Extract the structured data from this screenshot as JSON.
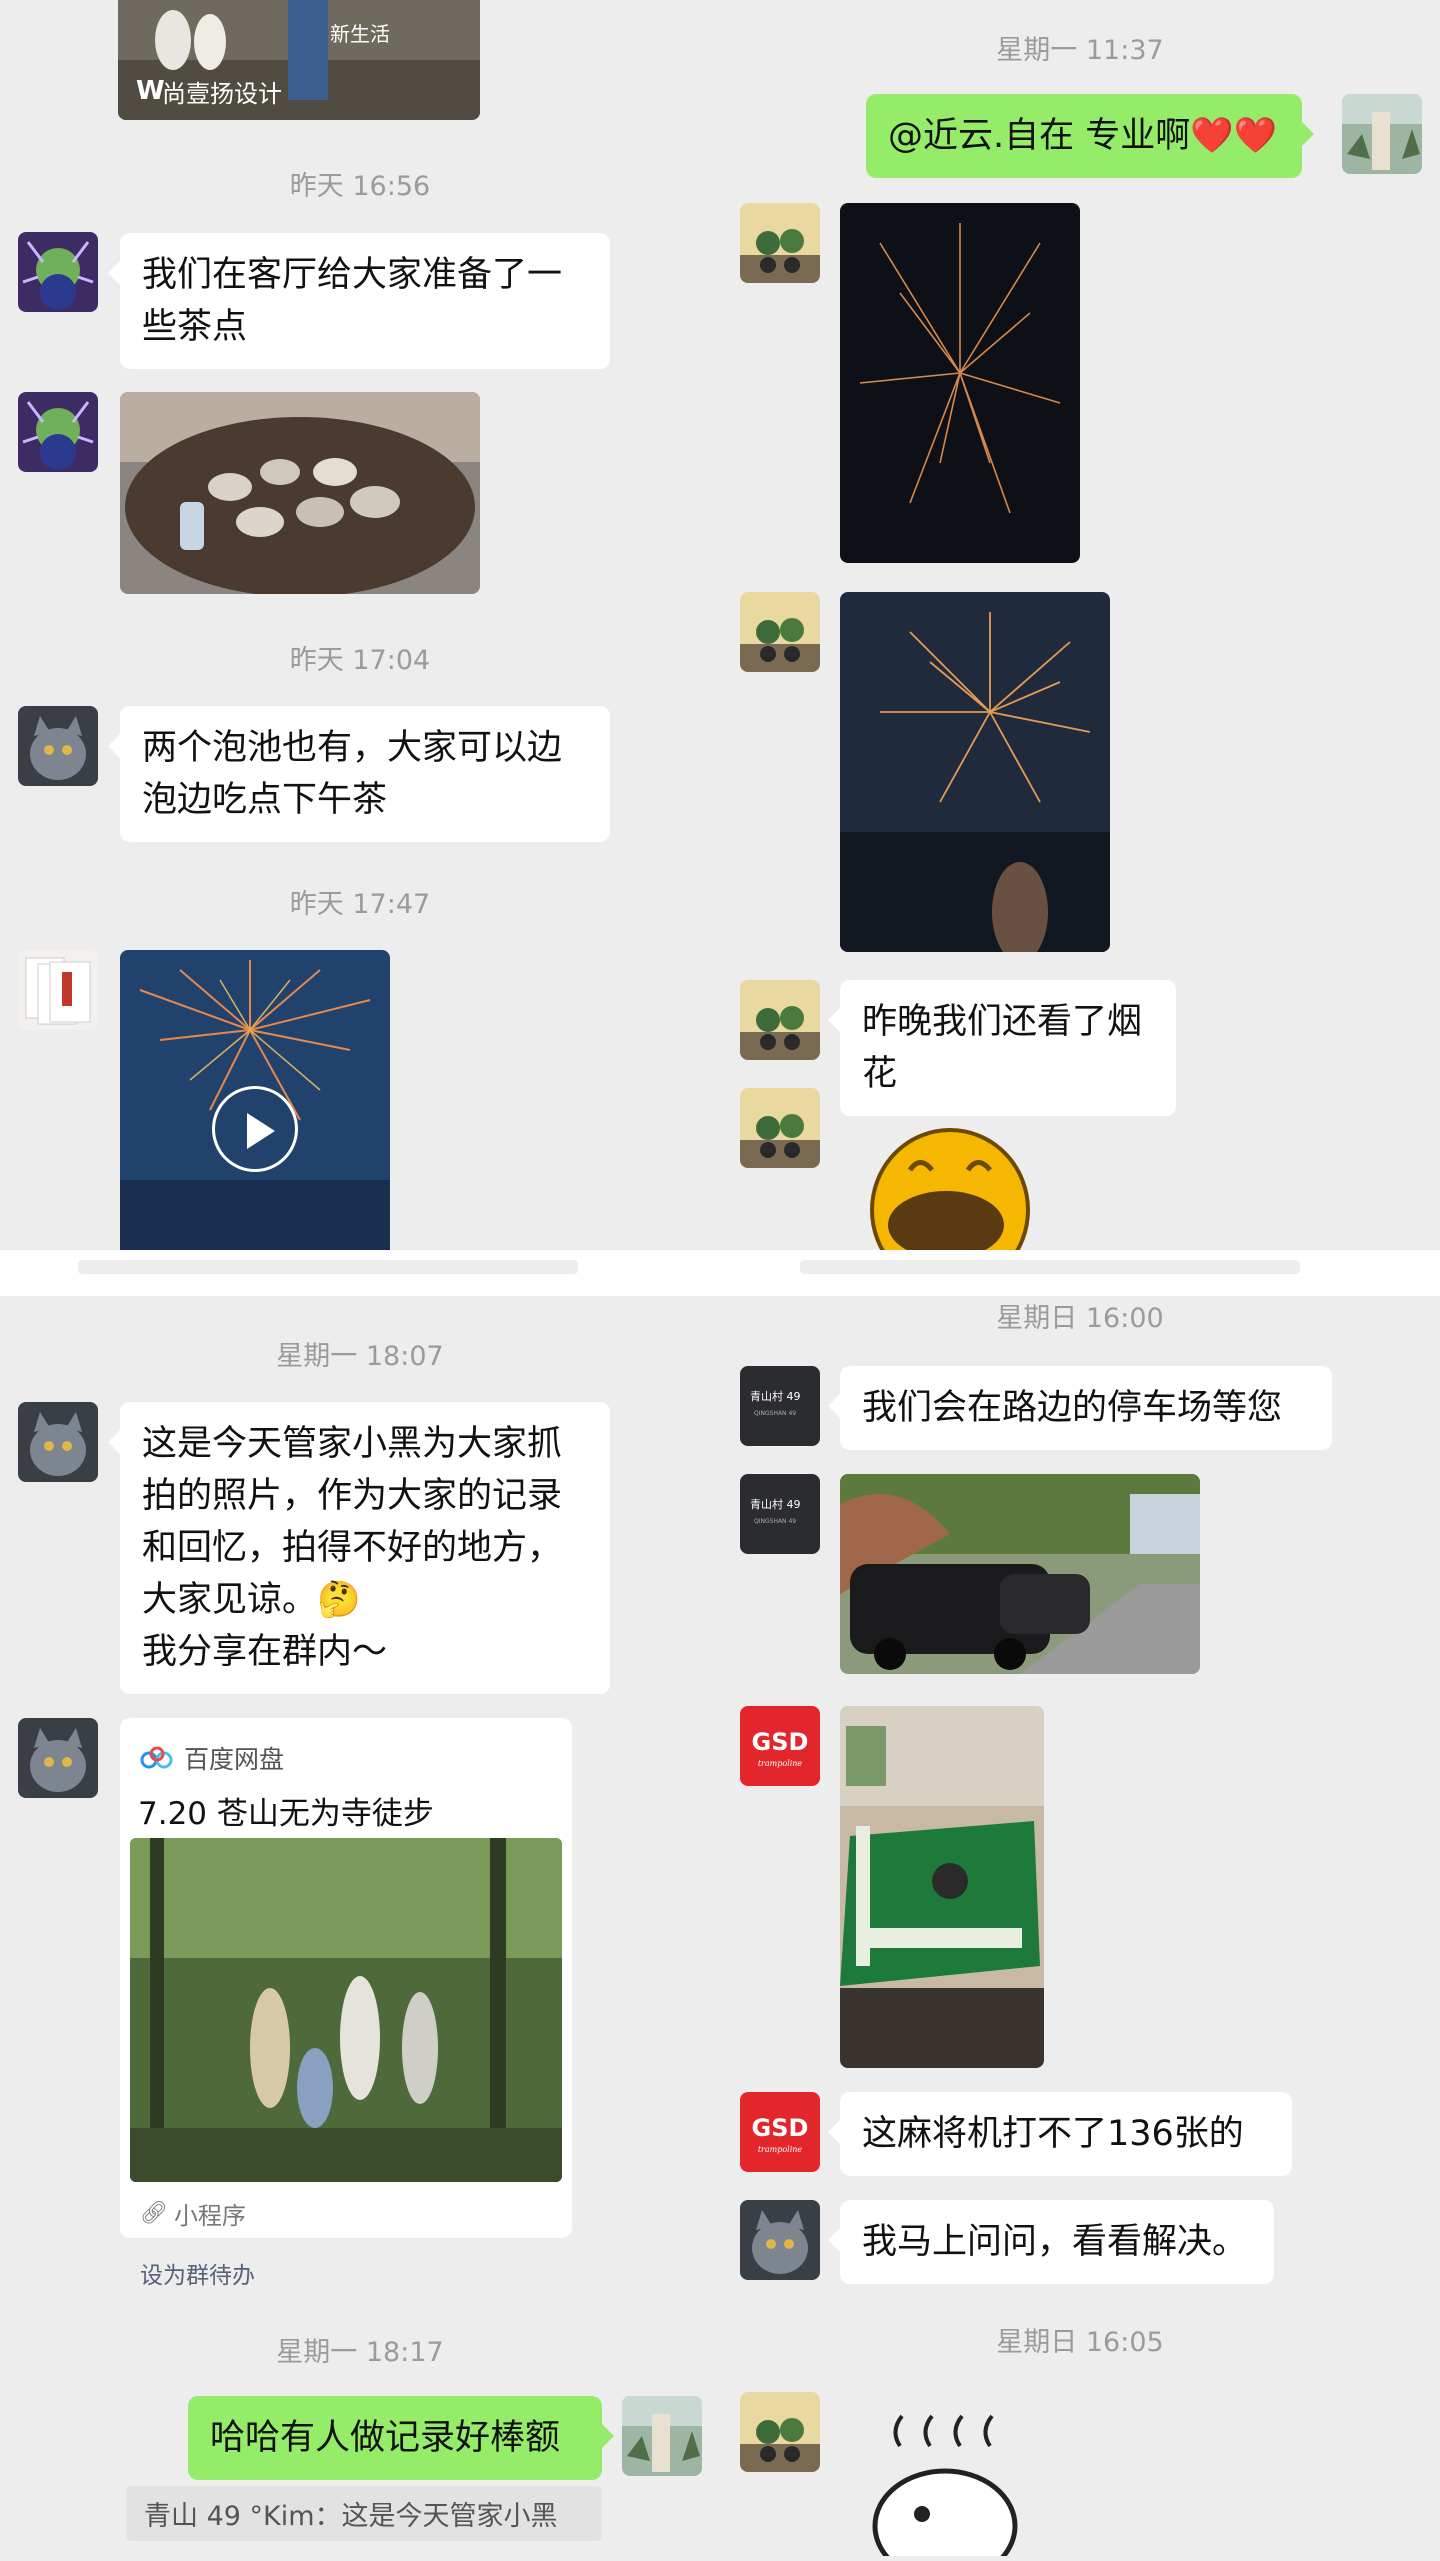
{
  "timestamps": {
    "t_mon_1137": "星期一 11:37",
    "t_yest_1656": "昨天 16:56",
    "t_yest_1704": "昨天 17:04",
    "t_yest_1747": "昨天 17:47",
    "t_mon_1807": "星期一 18:07",
    "t_mon_1817": "星期一 18:17",
    "t_sun_1600": "星期日 16:00",
    "t_sun_1605": "星期日 16:05"
  },
  "image_overlays": {
    "top_logo": "尚壹扬设计",
    "top_overlay": "新生活",
    "sign_line1": "青山村 49",
    "sign_line2": "QINGSHAN 49"
  },
  "messages": {
    "m_pro": "@近云.自在 专业啊❤️❤️",
    "m_tea": "我们在客厅给大家准备了一些茶点",
    "m_pool": "两个泡池也有，大家可以边泡边吃点下午茶",
    "m_fireworks": "昨晚我们还看了烟花",
    "m_photos": "这是今天管家小黑为大家抓拍的照片，作为大家的记录和回忆，拍得不好的地方，大家见谅。🤔\n我分享在群内～",
    "m_haha": "哈哈有人做记录好棒额",
    "m_parking": "我们会在路边的停车场等您",
    "m_mahjong": "这麻将机打不了136张的",
    "m_ask": "我马上问问，看看解决。"
  },
  "mini_program": {
    "source": "百度网盘",
    "title": "7.20 苍山无为寺徒步",
    "footer": "小程序",
    "todo": "设为群待办"
  },
  "quote": "青山 49 °Kim：这是今天管家小黑",
  "colors": {
    "background": "#ededed",
    "bubble_white": "#ffffff",
    "bubble_green": "#95ec69",
    "timestamp": "#9b9b9b",
    "link": "#57627a",
    "gsd_red": "#e3262c"
  }
}
